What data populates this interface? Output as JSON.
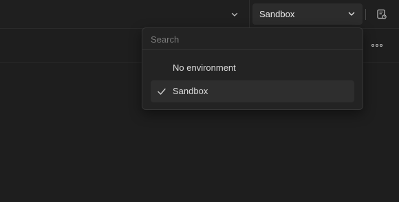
{
  "header": {
    "environment_selector": {
      "selected": "Sandbox",
      "icon": "chevron-down-icon"
    },
    "tab_chevron_icon": "chevron-down-icon",
    "environment_settings_icon": "environment-settings-icon"
  },
  "toolbar": {
    "more_icon": "more-options-icon"
  },
  "dropdown": {
    "search_placeholder": "Search",
    "options": [
      {
        "label": "No environment",
        "selected": false
      },
      {
        "label": "Sandbox",
        "selected": true
      }
    ],
    "selected_icon": "checkmark-icon"
  },
  "colors": {
    "background": "#1e1e1e",
    "select_background": "#2c2c2c",
    "dropdown_background": "#232323",
    "selected_item_background": "#2e2e2e",
    "text": "#e6e6e6",
    "placeholder": "#7a7a7a"
  }
}
